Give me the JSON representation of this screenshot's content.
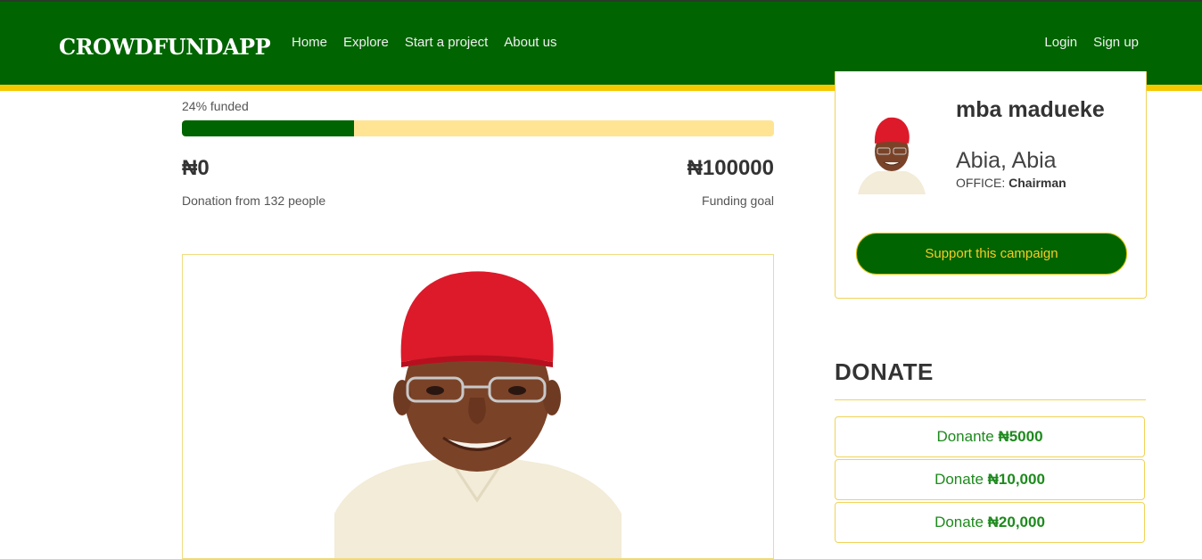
{
  "nav": {
    "brand": "CROWDFUNDAPP",
    "links": [
      "Home",
      "Explore",
      "Start a project",
      "About us"
    ],
    "auth": [
      "Login",
      "Sign up"
    ]
  },
  "campaign": {
    "funded_label": "24% funded",
    "funded_fraction": 0.29,
    "raised": "₦0",
    "raised_caption": "Donation from 132 people",
    "goal": "₦100000",
    "goal_caption": "Funding goal"
  },
  "profile": {
    "name": "mba madueke",
    "location": "Abia, Abia",
    "office_label": "OFFICE:",
    "office_value": "Chairman",
    "support_label": "Support this campaign"
  },
  "donate": {
    "title": "DONATE",
    "options": [
      {
        "prefix": "Donante",
        "amount": "₦5000"
      },
      {
        "prefix": "Donate",
        "amount": "₦10,000"
      },
      {
        "prefix": "Donate",
        "amount": "₦20,000"
      }
    ]
  },
  "colors": {
    "brand_green": "#006400",
    "accent_yellow": "#f5c800",
    "progress_track": "#ffe494",
    "donate_text": "#1d8a1d"
  }
}
